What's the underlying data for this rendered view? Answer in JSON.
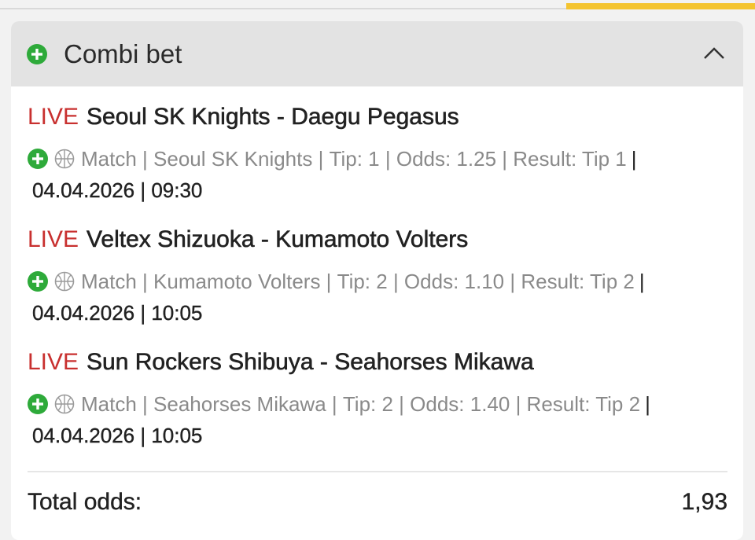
{
  "colors": {
    "accent_yellow": "#f4c430",
    "live_red": "#c8302f",
    "plus_green": "#2eaa3a",
    "header_bg": "#e3e3e3"
  },
  "combi": {
    "title": "Combi bet",
    "plus_icon": "plus-circle-icon",
    "collapse_icon": "chevron-up-icon"
  },
  "bets": [
    {
      "live": "LIVE",
      "match": "Seoul SK Knights - Daegu Pegasus",
      "market": "Match",
      "selection": "Seoul SK Knights",
      "tip": "Tip: 1",
      "odds": "Odds: 1.25",
      "result": "Result: Tip 1",
      "date": "04.04.2026 | 09:30"
    },
    {
      "live": "LIVE",
      "match": "Veltex Shizuoka - Kumamoto Volters",
      "market": "Match",
      "selection": "Kumamoto Volters",
      "tip": "Tip: 2",
      "odds": "Odds: 1.10",
      "result": "Result: Tip 2",
      "date": "04.04.2026 | 10:05"
    },
    {
      "live": "LIVE",
      "match": "Sun Rockers Shibuya - Seahorses Mikawa",
      "market": "Match",
      "selection": "Seahorses Mikawa",
      "tip": "Tip: 2",
      "odds": "Odds: 1.40",
      "result": "Result: Tip 2",
      "date": "04.04.2026 | 10:05"
    }
  ],
  "total": {
    "label": "Total odds:",
    "value": "1,93"
  }
}
